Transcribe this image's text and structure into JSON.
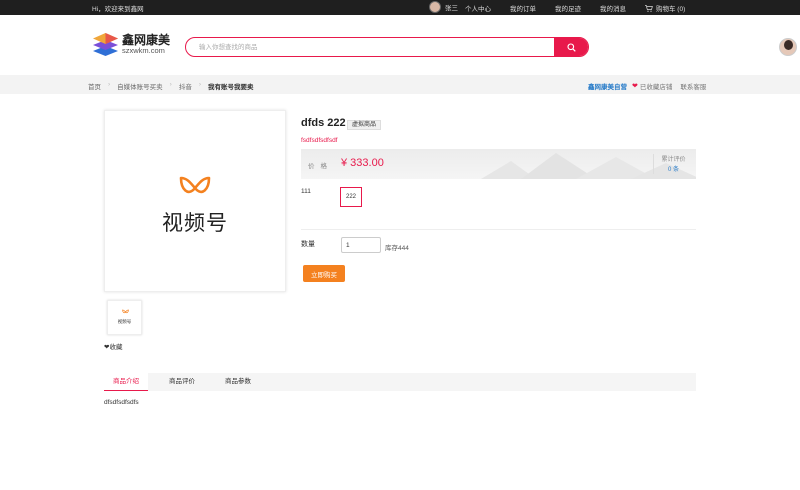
{
  "topbar": {
    "welcome": "Hi，欢迎来到鑫网",
    "username": "张三",
    "links": [
      "个人中心",
      "我的订单",
      "我的足迹",
      "我的消息"
    ],
    "cart": "购物车 (0)"
  },
  "logo": {
    "name": "鑫网康美",
    "domain": "szxwkm.com"
  },
  "search": {
    "placeholder": "输入你想查找的商品"
  },
  "breadcrumb": [
    "首页",
    "自媒体账号买卖",
    "抖音",
    "我有账号我要卖"
  ],
  "shop": {
    "name": "鑫网康美自营",
    "favorite": "已收藏店铺",
    "service": "联系客服"
  },
  "product": {
    "image_text": "视频号",
    "thumb_text": "视频号",
    "collect": "❤收藏",
    "title": "dfds 222",
    "tag": "虚拟商品",
    "subtitle": "fsdfsdfsdfsdf",
    "price_label": "价格",
    "price": "¥ 333.00",
    "review_label": "累计评价",
    "review_count": "0 条",
    "option_label": "111",
    "option_value": "222",
    "qty_label": "数量",
    "qty_value": "1",
    "stock": "库存444",
    "buy_label": "立即购买"
  },
  "tabs": [
    "商品介绍",
    "商品评价",
    "商品参数"
  ],
  "description": "dfsdfsdfsdfs",
  "colors": {
    "accent": "#e8194b",
    "buy": "#f4811f",
    "link": "#2a7dc9",
    "topbar": "#1f1f1f"
  }
}
